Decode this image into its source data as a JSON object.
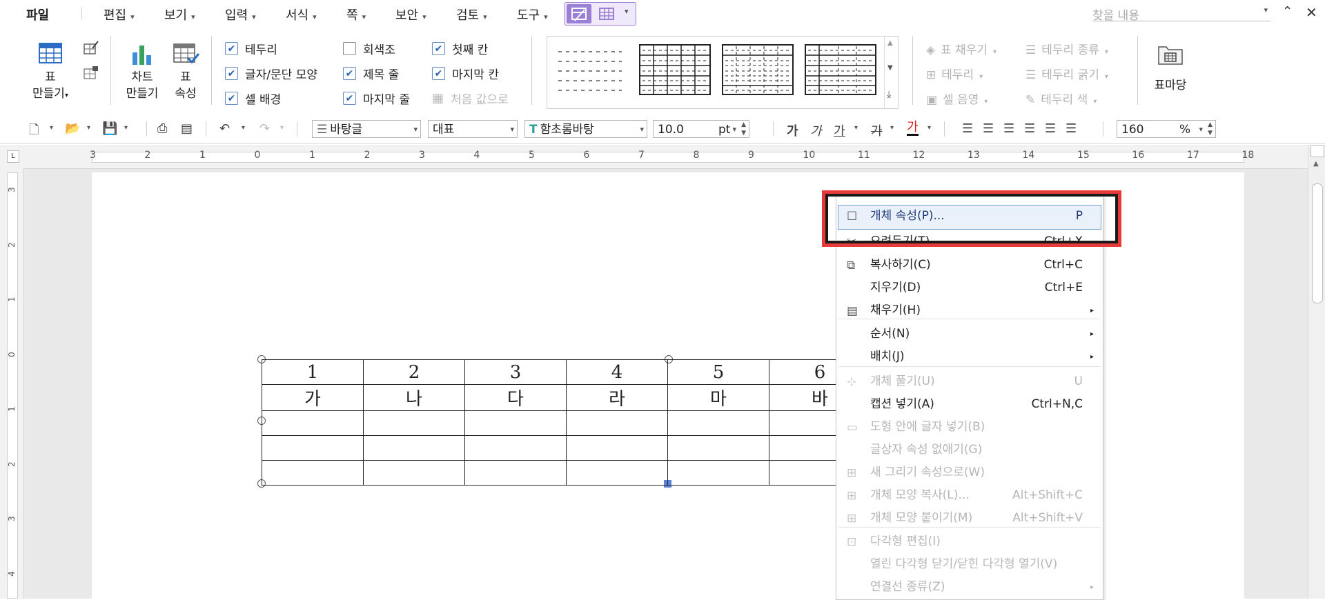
{
  "menubar": {
    "items": [
      "파일",
      "편집",
      "보기",
      "입력",
      "서식",
      "쪽",
      "보안",
      "검토",
      "도구"
    ],
    "search_placeholder": "찾을 내용"
  },
  "ribbon": {
    "make_table": "표\n만들기",
    "make_chart": "차트\n만들기",
    "table_props": "표\n속성",
    "checks": [
      {
        "label": "테두리",
        "checked": true
      },
      {
        "label": "글자/문단 모양",
        "checked": true
      },
      {
        "label": "셀 배경",
        "checked": true
      },
      {
        "label": "회색조",
        "checked": false
      },
      {
        "label": "제목 줄",
        "checked": true
      },
      {
        "label": "마지막 줄",
        "checked": true
      },
      {
        "label": "첫째 칸",
        "checked": true
      },
      {
        "label": "마지막 칸",
        "checked": true
      },
      {
        "label": "처음 값으로",
        "checked": false,
        "disabled": true
      }
    ],
    "table_fill": "표 채우기",
    "border": "테두리",
    "cell_shade": "셀 음영",
    "border_type": "테두리 종류",
    "border_width": "테두리 굵기",
    "border_color": "테두리 색",
    "table_madang": "표마당"
  },
  "toolbar": {
    "para_style": "바탕글",
    "lang": "대표",
    "font": "함초롬바탕",
    "size": "10.0",
    "size_unit": "pt",
    "zoom": "160",
    "zoom_unit": "%",
    "font_style_glyph": "가",
    "colors": {
      "font": "#e02020",
      "accent": "#9b7fd6"
    }
  },
  "ruler": {
    "h_numbers": [
      "3",
      "2",
      "1",
      "0",
      "1",
      "2",
      "3",
      "4",
      "5",
      "6",
      "7",
      "8",
      "9",
      "10",
      "11",
      "12",
      "13",
      "14",
      "15",
      "16",
      "17",
      "18"
    ],
    "v_numbers": [
      "3",
      "2",
      "1",
      "0",
      "1",
      "2",
      "3",
      "4"
    ]
  },
  "table": {
    "rows": [
      [
        "1",
        "2",
        "3",
        "4",
        "5",
        "6"
      ],
      [
        "가",
        "나",
        "다",
        "라",
        "마",
        "바"
      ],
      [
        "",
        "",
        "",
        "",
        "",
        ""
      ],
      [
        "",
        "",
        "",
        "",
        "",
        ""
      ],
      [
        "",
        "",
        "",
        "",
        "",
        ""
      ]
    ]
  },
  "context_menu": {
    "items": [
      {
        "label": "개체 속성(P)...",
        "shortcut": "P",
        "enabled": true,
        "highlighted": true
      },
      {
        "label": "오려두기(T)",
        "shortcut": "Ctrl+X",
        "enabled": true
      },
      {
        "label": "복사하기(C)",
        "shortcut": "Ctrl+C",
        "enabled": true
      },
      {
        "label": "지우기(D)",
        "shortcut": "Ctrl+E",
        "enabled": true
      },
      {
        "label": "채우기(H)",
        "shortcut": "",
        "enabled": true,
        "submenu": true
      },
      {
        "label": "순서(N)",
        "shortcut": "",
        "enabled": true,
        "submenu": true
      },
      {
        "label": "배치(J)",
        "shortcut": "",
        "enabled": true,
        "submenu": true
      },
      {
        "label": "개체 풀기(U)",
        "shortcut": "U",
        "enabled": false
      },
      {
        "label": "캡션 넣기(A)",
        "shortcut": "Ctrl+N,C",
        "enabled": true
      },
      {
        "label": "도형 안에 글자 넣기(B)",
        "shortcut": "",
        "enabled": false
      },
      {
        "label": "글상자 속성 없애기(G)",
        "shortcut": "",
        "enabled": false
      },
      {
        "label": "새 그리기 속성으로(W)",
        "shortcut": "",
        "enabled": false
      },
      {
        "label": "개체 모양 복사(L)...",
        "shortcut": "Alt+Shift+C",
        "enabled": false
      },
      {
        "label": "개체 모양 붙이기(M)",
        "shortcut": "Alt+Shift+V",
        "enabled": false
      },
      {
        "label": "다각형 편집(I)",
        "shortcut": "",
        "enabled": false
      },
      {
        "label": "열린 다각형 닫기/닫힌 다각형 열기(V)",
        "shortcut": "",
        "enabled": false
      },
      {
        "label": "연결선 종류(Z)",
        "shortcut": "",
        "enabled": false,
        "submenu": true
      }
    ]
  }
}
